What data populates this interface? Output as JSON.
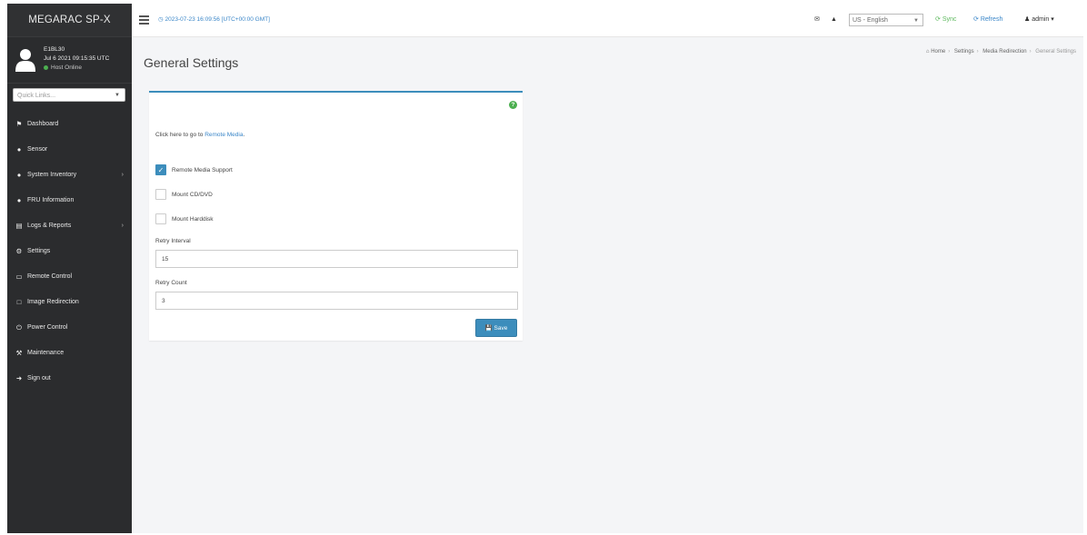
{
  "brand": "MEGARAC SP-X",
  "user": {
    "name": "E1BL30",
    "login_time": "Jul 6 2021 09:15:35 UTC",
    "status": "Host Online"
  },
  "quick_links": {
    "placeholder": "Quick Links..."
  },
  "sidebar": {
    "items": [
      {
        "label": "Dashboard",
        "icon": "dashboard-icon",
        "arrow": ""
      },
      {
        "label": "Sensor",
        "icon": "sensor-icon",
        "arrow": ""
      },
      {
        "label": "System Inventory",
        "icon": "inventory-icon",
        "arrow": "›"
      },
      {
        "label": "FRU Information",
        "icon": "info-icon",
        "arrow": ""
      },
      {
        "label": "Logs & Reports",
        "icon": "chart-icon",
        "arrow": "›"
      },
      {
        "label": "Settings",
        "icon": "gear-icon",
        "arrow": ""
      },
      {
        "label": "Remote Control",
        "icon": "monitor-icon",
        "arrow": ""
      },
      {
        "label": "Image Redirection",
        "icon": "image-redirection-icon",
        "arrow": ""
      },
      {
        "label": "Power Control",
        "icon": "power-icon",
        "arrow": ""
      },
      {
        "label": "Maintenance",
        "icon": "wrench-icon",
        "arrow": ""
      },
      {
        "label": "Sign out",
        "icon": "sign-out-icon",
        "arrow": ""
      }
    ]
  },
  "topbar": {
    "datetime": "2023-07-23 16:09:56 [UTC+00:00 GMT]",
    "language": "US - English",
    "sync": "Sync",
    "refresh": "Refresh",
    "user": "admin"
  },
  "page": {
    "title": "General Settings",
    "breadcrumb": [
      "Home",
      "Settings",
      "Media Redirection",
      "General Settings"
    ]
  },
  "form": {
    "link_text_prefix": "Click here to go to",
    "link_text": "Remote Media",
    "link_suffix": ".",
    "checkboxes": [
      {
        "label": "Remote Media Support",
        "checked": true
      },
      {
        "label": "Mount CD/DVD",
        "checked": false
      },
      {
        "label": "Mount Harddisk",
        "checked": false
      }
    ],
    "retry_interval": {
      "label": "Retry Interval",
      "value": "15"
    },
    "retry_count": {
      "label": "Retry Count",
      "value": "3"
    },
    "save_label": "Save"
  },
  "colors": {
    "sidebar_bg": "#2b2c2e",
    "accent": "#3c8dbc",
    "online": "#4caf50"
  }
}
